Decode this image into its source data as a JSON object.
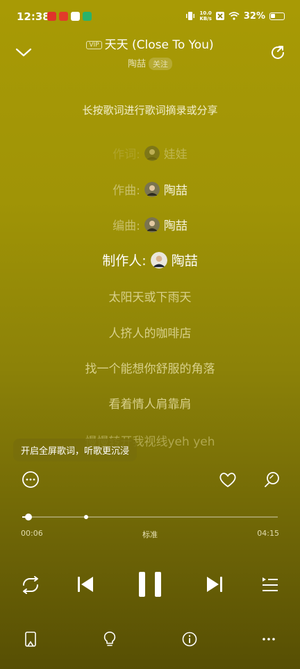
{
  "status_bar": {
    "time": "12:38",
    "net_speed_value": "10.0",
    "net_speed_unit": "KB/s",
    "battery": "32%"
  },
  "header": {
    "vip_label": "VIP",
    "song_title": "天天 (Close To You)",
    "artist": "陶喆",
    "follow_label": "关注"
  },
  "hint": "长按歌词进行歌词摘录或分享",
  "credits": [
    {
      "role": "作词:",
      "name": "娃娃"
    },
    {
      "role": "作曲:",
      "name": "陶喆"
    },
    {
      "role": "编曲:",
      "name": "陶喆"
    },
    {
      "role": "制作人:",
      "name": "陶喆"
    }
  ],
  "lyrics": [
    "太阳天或下雨天",
    "人挤人的咖啡店",
    "找一个能想你舒服的角落",
    "看着情人肩靠肩",
    "慢慢转开我视线yeh yeh"
  ],
  "tooltip": "开启全屏歌词，听歌更沉浸",
  "progress": {
    "current": "00:06",
    "total": "04:15",
    "fraction": 0.024,
    "buffered_fraction": 0.25,
    "quality": "标准"
  },
  "colors": {
    "accent": "#ffffff",
    "background_top": "#a89a05",
    "background_bottom": "#574f04"
  }
}
